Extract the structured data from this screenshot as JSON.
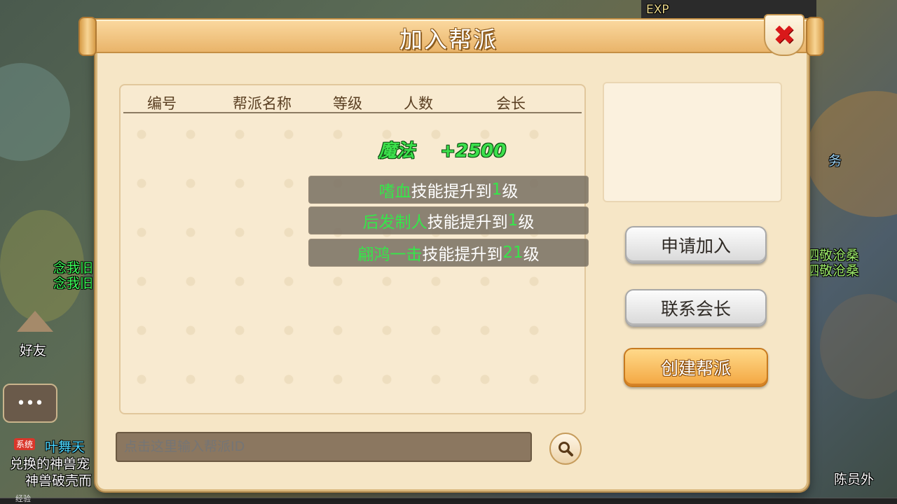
{
  "background": {
    "hud_exp": "EXP",
    "chat_lines": [
      "念我旧",
      "念我旧",
      "好友",
      "泗敬沧桑",
      "泗敬沧桑",
      "叶舞天",
      "兑换的神兽宠",
      "神兽破壳而",
      "陈员外",
      "务",
      "经验",
      "系统"
    ]
  },
  "dialog": {
    "title": "加入帮派",
    "close_symbol": "✖",
    "list": {
      "columns": [
        "编号",
        "帮派名称",
        "等级",
        "人数",
        "会长"
      ]
    },
    "notification": {
      "gain_text": "魔法    +2500",
      "skills": [
        {
          "name": "嗜血",
          "middle": "技能提升到",
          "level": "1",
          "suffix": "级"
        },
        {
          "name": "后发制人",
          "middle": "技能提升到",
          "level": "1",
          "suffix": "级"
        },
        {
          "name": "翩鸿一击",
          "middle": "技能提升到",
          "level": "21",
          "suffix": "级"
        }
      ]
    },
    "buttons": {
      "apply": "申请加入",
      "contact": "联系会长",
      "create": "创建帮派"
    },
    "search": {
      "placeholder": "点击这里输入帮派ID"
    }
  }
}
